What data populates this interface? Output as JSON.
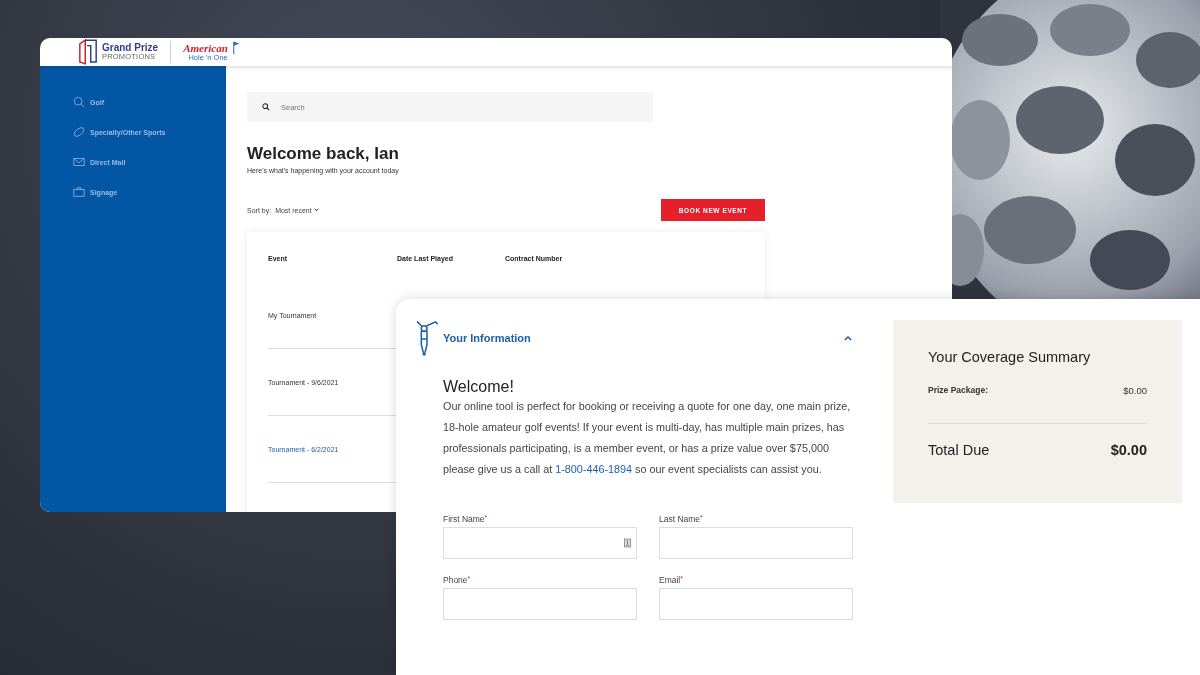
{
  "back_window": {
    "logo": {
      "brand_top": "Grand Prize",
      "brand_bottom": "PROMOTIONS",
      "partner_top": "American",
      "partner_bottom": "Hole 'n One"
    },
    "sidebar": {
      "items": [
        {
          "label": "Golf",
          "kind": "golf"
        },
        {
          "label": "Specialty/Other Sports",
          "kind": "football"
        },
        {
          "label": "Direct Mail",
          "kind": "mail"
        },
        {
          "label": "Signage",
          "kind": "sign"
        }
      ]
    },
    "search": {
      "placeholder": "Search"
    },
    "title": "Welcome back, Ian",
    "subtitle": "Here's what's happening with your account today",
    "sort": {
      "label": "Sort by:",
      "value": "Most recent"
    },
    "book_button": "BOOK NEW EVENT",
    "table": {
      "columns": [
        "Event",
        "Date Last Played",
        "Contract Number"
      ],
      "rows": [
        {
          "event": "My Tournament",
          "kind": "plain"
        },
        {
          "event": "Tournament - 9/6/2021",
          "kind": "plain"
        },
        {
          "event": "Tournament - 6/2/2021",
          "kind": "link"
        }
      ]
    }
  },
  "front_window": {
    "panel": {
      "title": "Your Information",
      "expanded": true,
      "heading": "Welcome!",
      "intro": {
        "before": "Our online tool is perfect for booking or receiving a quote for one day, one main prize, 18-hole amateur golf events! If your event is multi-day, has multiple main prizes, has professionals participating, is a member event, or has a prize value over $75,000 please give us a call at",
        "phone": "1-800-446-1894",
        "after": "so our event specialists can assist you."
      },
      "fields": [
        {
          "label": "First Name",
          "required_mark": "*",
          "autofill_icon": true
        },
        {
          "label": "Last Name",
          "required_mark": "*",
          "autofill_icon": false
        },
        {
          "label": "Phone",
          "required_mark": "*",
          "autofill_icon": false
        },
        {
          "label": "Email",
          "required_mark": "*",
          "autofill_icon": false
        }
      ]
    },
    "summary": {
      "title": "Your Coverage Summary",
      "lines": [
        {
          "label": "Prize Package:",
          "value": "$0.00"
        }
      ],
      "total_label": "Total Due",
      "total_value": "$0.00"
    }
  }
}
